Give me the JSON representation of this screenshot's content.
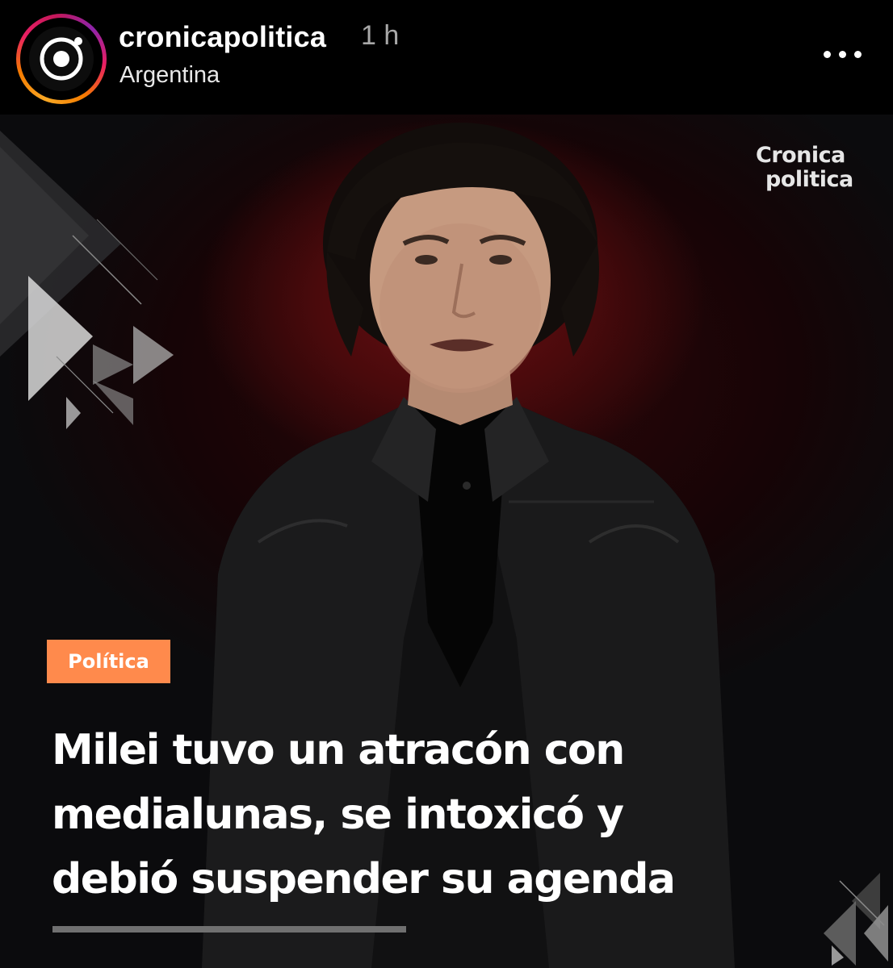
{
  "header": {
    "username": "cronicapolitica",
    "time": "1 h",
    "location": "Argentina",
    "more_icon": "more-horizontal-icon",
    "avatar_icon": "cronicapolitica-logo-icon"
  },
  "post": {
    "brand_mark": {
      "line1": "Cronica",
      "line2": "politica"
    },
    "category": "Política",
    "headline": {
      "line1": "Milei tuvo un atracón con",
      "line2": "medialunas, se intoxicó y",
      "line3": "debió suspender su agenda"
    },
    "colors": {
      "badge": "#ff8a4c",
      "background_accent": "#5a0c0f",
      "avatar_ring_start": "#f9a825",
      "avatar_ring_end": "#e91e63"
    }
  }
}
